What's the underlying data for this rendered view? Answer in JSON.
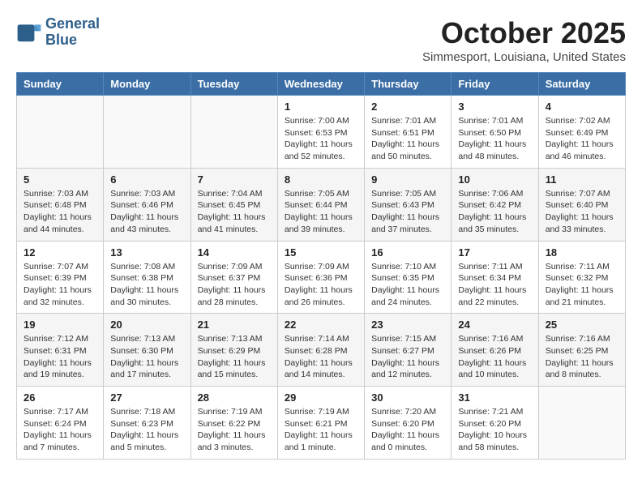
{
  "header": {
    "logo_line1": "General",
    "logo_line2": "Blue",
    "month": "October 2025",
    "location": "Simmesport, Louisiana, United States"
  },
  "weekdays": [
    "Sunday",
    "Monday",
    "Tuesday",
    "Wednesday",
    "Thursday",
    "Friday",
    "Saturday"
  ],
  "weeks": [
    [
      {
        "day": "",
        "info": ""
      },
      {
        "day": "",
        "info": ""
      },
      {
        "day": "",
        "info": ""
      },
      {
        "day": "1",
        "info": "Sunrise: 7:00 AM\nSunset: 6:53 PM\nDaylight: 11 hours and 52 minutes."
      },
      {
        "day": "2",
        "info": "Sunrise: 7:01 AM\nSunset: 6:51 PM\nDaylight: 11 hours and 50 minutes."
      },
      {
        "day": "3",
        "info": "Sunrise: 7:01 AM\nSunset: 6:50 PM\nDaylight: 11 hours and 48 minutes."
      },
      {
        "day": "4",
        "info": "Sunrise: 7:02 AM\nSunset: 6:49 PM\nDaylight: 11 hours and 46 minutes."
      }
    ],
    [
      {
        "day": "5",
        "info": "Sunrise: 7:03 AM\nSunset: 6:48 PM\nDaylight: 11 hours and 44 minutes."
      },
      {
        "day": "6",
        "info": "Sunrise: 7:03 AM\nSunset: 6:46 PM\nDaylight: 11 hours and 43 minutes."
      },
      {
        "day": "7",
        "info": "Sunrise: 7:04 AM\nSunset: 6:45 PM\nDaylight: 11 hours and 41 minutes."
      },
      {
        "day": "8",
        "info": "Sunrise: 7:05 AM\nSunset: 6:44 PM\nDaylight: 11 hours and 39 minutes."
      },
      {
        "day": "9",
        "info": "Sunrise: 7:05 AM\nSunset: 6:43 PM\nDaylight: 11 hours and 37 minutes."
      },
      {
        "day": "10",
        "info": "Sunrise: 7:06 AM\nSunset: 6:42 PM\nDaylight: 11 hours and 35 minutes."
      },
      {
        "day": "11",
        "info": "Sunrise: 7:07 AM\nSunset: 6:40 PM\nDaylight: 11 hours and 33 minutes."
      }
    ],
    [
      {
        "day": "12",
        "info": "Sunrise: 7:07 AM\nSunset: 6:39 PM\nDaylight: 11 hours and 32 minutes."
      },
      {
        "day": "13",
        "info": "Sunrise: 7:08 AM\nSunset: 6:38 PM\nDaylight: 11 hours and 30 minutes."
      },
      {
        "day": "14",
        "info": "Sunrise: 7:09 AM\nSunset: 6:37 PM\nDaylight: 11 hours and 28 minutes."
      },
      {
        "day": "15",
        "info": "Sunrise: 7:09 AM\nSunset: 6:36 PM\nDaylight: 11 hours and 26 minutes."
      },
      {
        "day": "16",
        "info": "Sunrise: 7:10 AM\nSunset: 6:35 PM\nDaylight: 11 hours and 24 minutes."
      },
      {
        "day": "17",
        "info": "Sunrise: 7:11 AM\nSunset: 6:34 PM\nDaylight: 11 hours and 22 minutes."
      },
      {
        "day": "18",
        "info": "Sunrise: 7:11 AM\nSunset: 6:32 PM\nDaylight: 11 hours and 21 minutes."
      }
    ],
    [
      {
        "day": "19",
        "info": "Sunrise: 7:12 AM\nSunset: 6:31 PM\nDaylight: 11 hours and 19 minutes."
      },
      {
        "day": "20",
        "info": "Sunrise: 7:13 AM\nSunset: 6:30 PM\nDaylight: 11 hours and 17 minutes."
      },
      {
        "day": "21",
        "info": "Sunrise: 7:13 AM\nSunset: 6:29 PM\nDaylight: 11 hours and 15 minutes."
      },
      {
        "day": "22",
        "info": "Sunrise: 7:14 AM\nSunset: 6:28 PM\nDaylight: 11 hours and 14 minutes."
      },
      {
        "day": "23",
        "info": "Sunrise: 7:15 AM\nSunset: 6:27 PM\nDaylight: 11 hours and 12 minutes."
      },
      {
        "day": "24",
        "info": "Sunrise: 7:16 AM\nSunset: 6:26 PM\nDaylight: 11 hours and 10 minutes."
      },
      {
        "day": "25",
        "info": "Sunrise: 7:16 AM\nSunset: 6:25 PM\nDaylight: 11 hours and 8 minutes."
      }
    ],
    [
      {
        "day": "26",
        "info": "Sunrise: 7:17 AM\nSunset: 6:24 PM\nDaylight: 11 hours and 7 minutes."
      },
      {
        "day": "27",
        "info": "Sunrise: 7:18 AM\nSunset: 6:23 PM\nDaylight: 11 hours and 5 minutes."
      },
      {
        "day": "28",
        "info": "Sunrise: 7:19 AM\nSunset: 6:22 PM\nDaylight: 11 hours and 3 minutes."
      },
      {
        "day": "29",
        "info": "Sunrise: 7:19 AM\nSunset: 6:21 PM\nDaylight: 11 hours and 1 minute."
      },
      {
        "day": "30",
        "info": "Sunrise: 7:20 AM\nSunset: 6:20 PM\nDaylight: 11 hours and 0 minutes."
      },
      {
        "day": "31",
        "info": "Sunrise: 7:21 AM\nSunset: 6:20 PM\nDaylight: 10 hours and 58 minutes."
      },
      {
        "day": "",
        "info": ""
      }
    ]
  ]
}
